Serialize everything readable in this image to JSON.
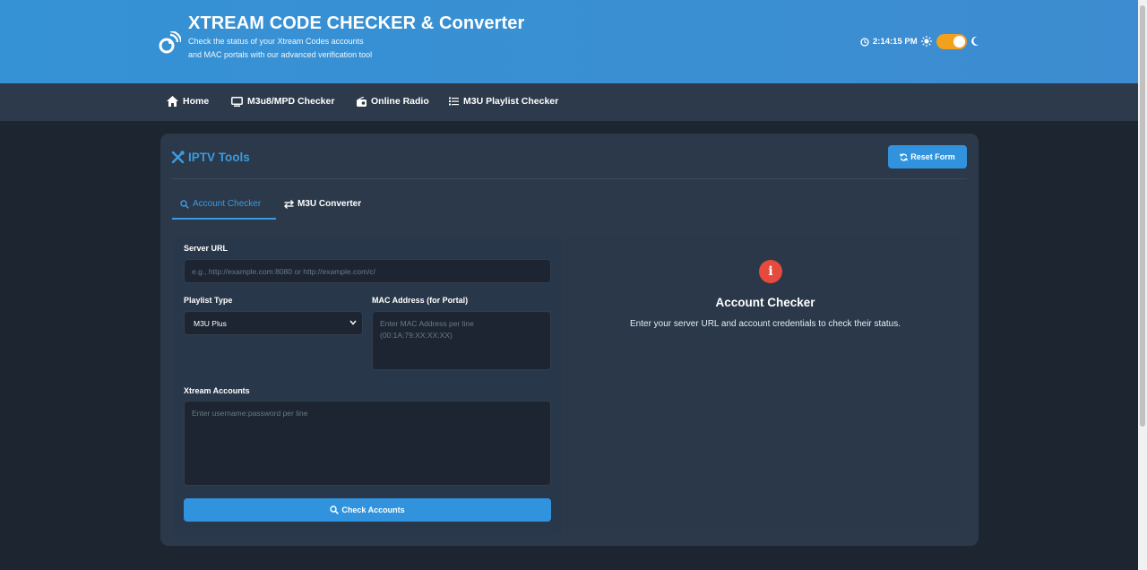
{
  "header": {
    "title": "XTREAM CODE CHECKER & Converter",
    "subtitle": "Check the status of your Xtream Codes accounts and MAC portals with our advanced verification tool",
    "time": "2:14:15 PM",
    "theme_toggle": "on"
  },
  "nav": {
    "items": [
      {
        "label": "Home",
        "icon": "home-icon"
      },
      {
        "label": "M3u8/MPD Checker",
        "icon": "tv-icon"
      },
      {
        "label": "Online Radio",
        "icon": "radio-icon"
      },
      {
        "label": "M3U Playlist Checker",
        "icon": "list-icon"
      }
    ]
  },
  "card": {
    "title": "IPTV Tools",
    "reset_label": "Reset Form",
    "tabs": [
      {
        "label": "Account Checker",
        "active": true
      },
      {
        "label": "M3U Converter",
        "active": false
      }
    ]
  },
  "form": {
    "server_url_label": "Server URL",
    "server_url_placeholder": "e.g., http://example.com:8080 or http://example.com/c/",
    "playlist_type_label": "Playlist Type",
    "playlist_type_value": "M3U Plus",
    "mac_label": "MAC Address (for Portal)",
    "mac_placeholder": "Enter MAC Address per line\n(00:1A:79:XX:XX:XX)",
    "accounts_label": "Xtream Accounts",
    "accounts_placeholder": "Enter username:password per line",
    "check_label": "Check Accounts"
  },
  "result": {
    "title": "Account Checker",
    "description": "Enter your server URL and account credentials to check their status."
  },
  "colors": {
    "accent": "#3193de",
    "header": "#3592d4",
    "background": "#1d2530",
    "card": "#2b394a",
    "info": "#e64a3c",
    "toggle": "#f2a11c"
  }
}
